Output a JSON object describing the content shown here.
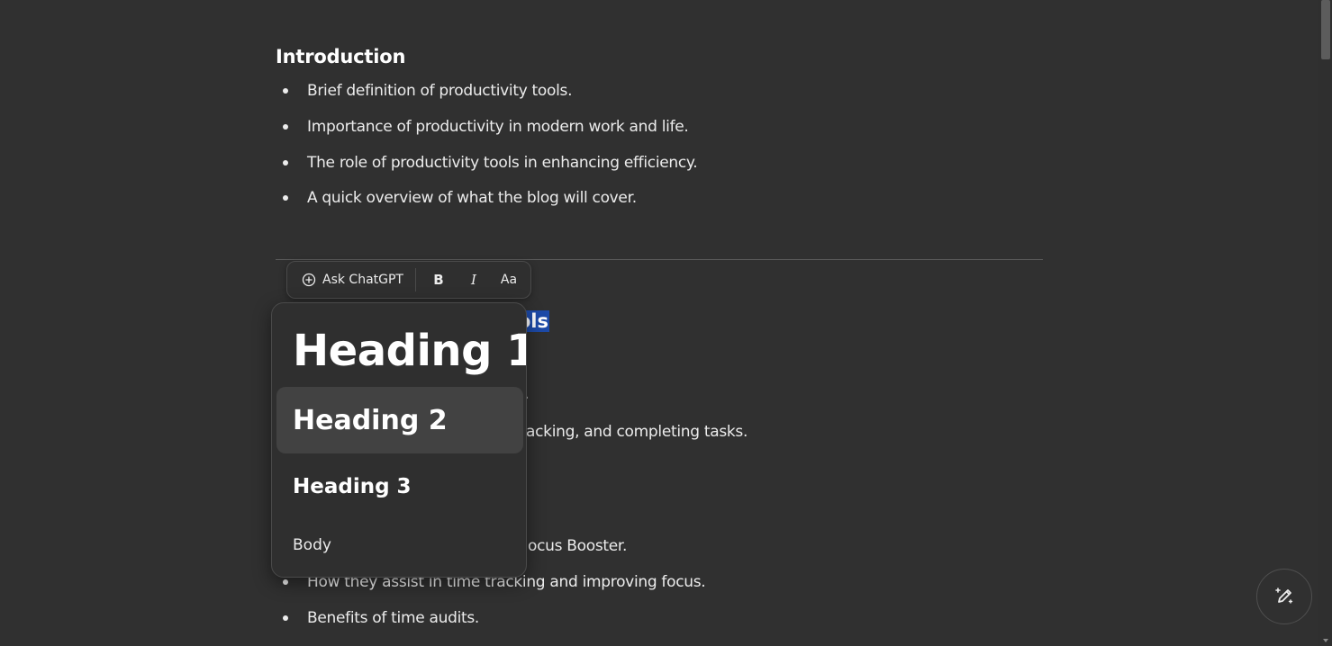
{
  "document": {
    "intro_heading": "Introduction",
    "intro_bullets": [
      "Brief definition of productivity tools.",
      "Importance of productivity in modern work and life.",
      "The role of productivity tools in enhancing efficiency.",
      "A quick overview of what the blog will cover."
    ],
    "selected_heading_tail": "ols",
    "partial_line_1": ".",
    "partial_line_2": "acking, and completing tasks.",
    "partial_line_3": "ocus Booster.",
    "lower_bullets": [
      "How they assist in time tracking and improving focus.",
      "Benefits of time audits."
    ]
  },
  "toolbar": {
    "ask_label": "Ask ChatGPT",
    "bold_label": "B",
    "italic_label": "I",
    "size_label": "Aa"
  },
  "format_menu": {
    "items": [
      {
        "label": "Heading 1"
      },
      {
        "label": "Heading 2",
        "highlighted": true
      },
      {
        "label": "Heading 3"
      },
      {
        "label": "Body"
      }
    ]
  },
  "icons": {
    "ask": "plus-circle-icon",
    "fab": "edit-sparkle-icon"
  },
  "colors": {
    "background": "#303030",
    "selection": "#1d4aa8",
    "menu_highlight": "#424242"
  }
}
